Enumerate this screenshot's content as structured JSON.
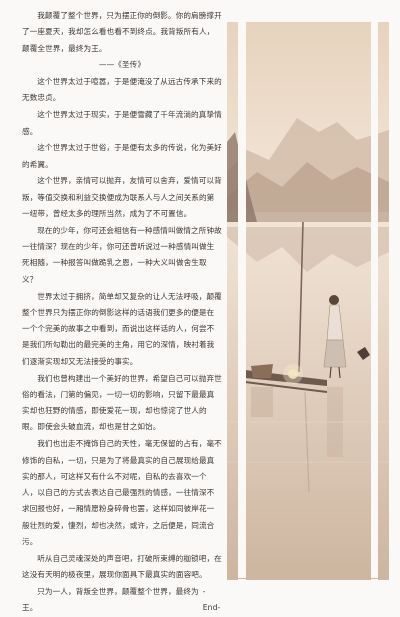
{
  "paragraphs": [
    "我颠覆了整个世界，只为摆正你的倒影。你的肩膀撑开了一座夏天，我却怎么看也看不到终点。我背叛所有人，颠覆全世界，最终为王。",
    "——《圣传》",
    "这个世界太过于喧嚣，于是便淹没了从远古传承下来的无数忠贞。",
    "这个世界太过于现实，于是便雪藏了千年流淌的真挚情感。",
    "这个世界太过于世俗，于是便有太多的传说，化为美好的希翼。",
    "这个世界，亲情可以抛弃，友情可以舍弃，爱情可以背叛，等值交换和利益交换便成为联系人与人之间关系的第一纽带，曾经太多的理所当然，成为了不可置信。",
    "现在的少年，你可还会相信有一种感情叫做情之所钟故一往情深？现在的少年，你可还曾听说过一种感情叫做生死相随，一种报答叫做跪乳之恩，一种大义叫做舍生取义？",
    "世界太过于拥挤，简单却又复杂的让人无法呼吸，颠覆整个世界只为摆正你的倒影这样的话语我们更多的便是在一个个完美的故事之中看到，而说出这样话的人，何尝不是我们所勾勒出的最完美的主角，用它的深情，映衬着我们逐渐实现却又无法接受的事实。",
    "我们也曾构建出一个美好的世界，希望自己可以抛弃世俗的看法，门第的偏见，一切一切的影响，只留下最最真实却也狂野的情感，即使爱花一现，却也惊诧了世人的眼。即使会头破血流，却也是甘之如饴。",
    "我们也出走不掩饰自己的天性，毫无保留的占有，毫不修饰的自私，一切，只是为了将最真实的自己展现给最真实的那人，可这样又有什么不对呢，自私的去喜欢一个人，以自己的方式去表达自己最强烈的情感，一往情深不求回报也好，一厢情愿粉身碎骨也罢，这样如同彼岸花一般壮烈的爱，悽烈，却也决然，或许，之后便是，同流合污。",
    "听从自己灵魂深处的声音吧，打破所束缚的枷锁吧，在这没有天明的极夜里，展现你面具下最真实的面容吧。",
    "只为一人，背叛全世界，颠覆整个世界，最终为王。"
  ],
  "end_mark": "-End-"
}
